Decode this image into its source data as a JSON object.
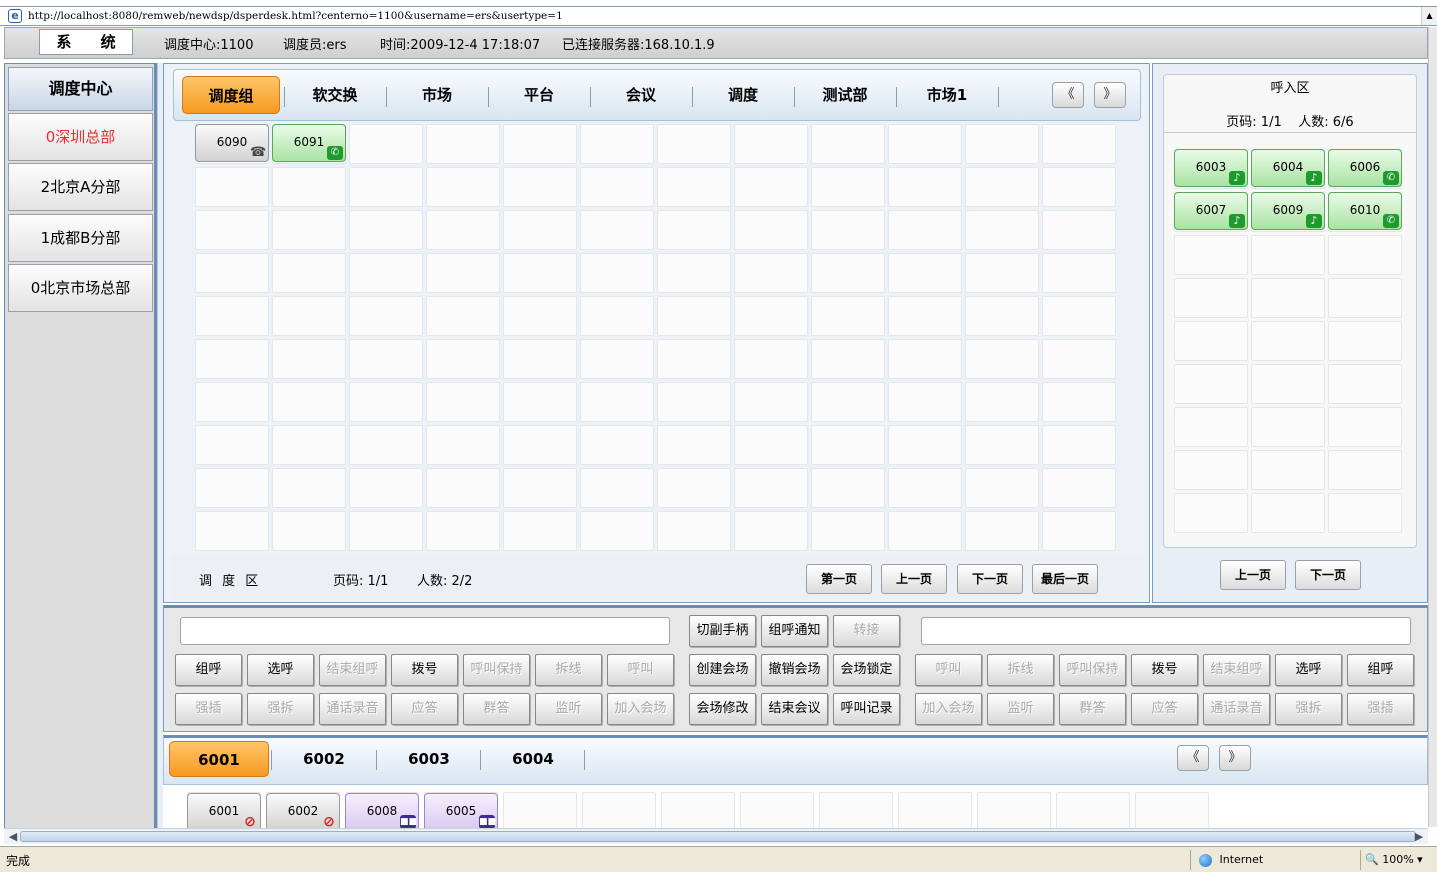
{
  "browser": {
    "url": "http://localhost:8080/remweb/newdsp/dsperdesk.html?centerno=1100&username=ers&usertype=1",
    "status": "完成",
    "zone": "Internet",
    "zoom": "100%"
  },
  "header": {
    "system_button": "系 统",
    "center": "调度中心:1100",
    "operator": "调度员:ers",
    "time": "时间:2009-12-4 17:18:07",
    "server": "已连接服务器:168.10.1.9"
  },
  "sidebar": {
    "title": "调度中心",
    "items": [
      {
        "label": "0深圳总部",
        "active": true
      },
      {
        "label": "2北京A分部",
        "active": false
      },
      {
        "label": "1成都B分部",
        "active": false
      },
      {
        "label": "0北京市场总部",
        "active": false
      }
    ]
  },
  "group_tabs": [
    "调度组",
    "软交换",
    "市场",
    "平台",
    "会议",
    "调度",
    "测试部",
    "市场1"
  ],
  "nav": {
    "prev": "《",
    "next": "》"
  },
  "dispatch_area": {
    "extensions": [
      {
        "num": "6090",
        "style": "gray",
        "status": "phone-icon"
      },
      {
        "num": "6091",
        "style": "green",
        "status": "talking-icon"
      }
    ],
    "label": "调 度 区",
    "page": "页码: 1/1",
    "count": "人数: 2/2",
    "buttons": {
      "first": "第一页",
      "prev": "上一页",
      "next": "下一页",
      "last": "最后一页"
    }
  },
  "incoming": {
    "title": "呼入区",
    "page": "页码: 1/1",
    "count": "人数: 6/6",
    "extensions": [
      {
        "num": "6003",
        "status": "music-icon"
      },
      {
        "num": "6004",
        "status": "music-icon"
      },
      {
        "num": "6006",
        "status": "ringing-icon"
      },
      {
        "num": "6007",
        "status": "music-icon"
      },
      {
        "num": "6009",
        "status": "music-icon"
      },
      {
        "num": "6010",
        "status": "ringing-icon"
      }
    ],
    "prev": "上一页",
    "next": "下一页"
  },
  "controls": {
    "left_row1": [
      {
        "label": "组呼",
        "enabled": true
      },
      {
        "label": "选呼",
        "enabled": true
      },
      {
        "label": "结束组呼",
        "enabled": false
      },
      {
        "label": "拨号",
        "enabled": true
      },
      {
        "label": "呼叫保持",
        "enabled": false
      },
      {
        "label": "拆线",
        "enabled": false
      },
      {
        "label": "呼叫",
        "enabled": false
      }
    ],
    "left_row2": [
      {
        "label": "强插",
        "enabled": false
      },
      {
        "label": "强拆",
        "enabled": false
      },
      {
        "label": "通话录音",
        "enabled": false
      },
      {
        "label": "应答",
        "enabled": false
      },
      {
        "label": "群答",
        "enabled": false
      },
      {
        "label": "监听",
        "enabled": false
      },
      {
        "label": "加入会场",
        "enabled": false
      }
    ],
    "mid_row0": [
      {
        "label": "切副手柄",
        "enabled": true
      },
      {
        "label": "组呼通知",
        "enabled": true
      },
      {
        "label": "转接",
        "enabled": false
      }
    ],
    "mid_row1": [
      {
        "label": "创建会场",
        "enabled": true
      },
      {
        "label": "撤销会场",
        "enabled": true
      },
      {
        "label": "会场锁定",
        "enabled": true
      }
    ],
    "mid_row2": [
      {
        "label": "会场修改",
        "enabled": true
      },
      {
        "label": "结束会议",
        "enabled": true
      },
      {
        "label": "呼叫记录",
        "enabled": true
      }
    ],
    "right_row1": [
      {
        "label": "呼叫",
        "enabled": false
      },
      {
        "label": "拆线",
        "enabled": false
      },
      {
        "label": "呼叫保持",
        "enabled": false
      },
      {
        "label": "拨号",
        "enabled": true
      },
      {
        "label": "结束组呼",
        "enabled": false
      },
      {
        "label": "选呼",
        "enabled": true
      },
      {
        "label": "组呼",
        "enabled": true
      }
    ],
    "right_row2": [
      {
        "label": "加入会场",
        "enabled": false
      },
      {
        "label": "监听",
        "enabled": false
      },
      {
        "label": "群答",
        "enabled": false
      },
      {
        "label": "应答",
        "enabled": false
      },
      {
        "label": "通话录音",
        "enabled": false
      },
      {
        "label": "强拆",
        "enabled": false
      },
      {
        "label": "强插",
        "enabled": false
      }
    ]
  },
  "bottom_tabs": [
    "6001",
    "6002",
    "6003",
    "6004"
  ],
  "bottom_extensions": [
    {
      "num": "6001",
      "style": "gray",
      "status": "blocked-icon"
    },
    {
      "num": "6002",
      "style": "gray",
      "status": "blocked-icon"
    },
    {
      "num": "6008",
      "style": "purple",
      "status": "conference-icon"
    },
    {
      "num": "6005",
      "style": "purple",
      "status": "conference-icon"
    }
  ]
}
